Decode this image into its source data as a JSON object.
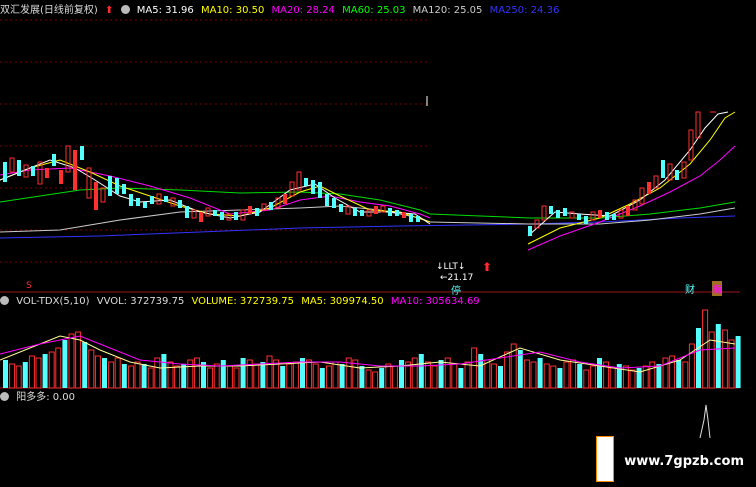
{
  "main_header": {
    "title": "双汇发展(日线前复权)",
    "ma5": "MA5: 31.96",
    "ma10": "MA10: 30.50",
    "ma20": "MA20: 28.24",
    "ma60": "MA60: 25.03",
    "ma120": "MA120: 25.05",
    "ma250": "MA250: 24.36"
  },
  "vol_header": {
    "name": "VOL-TDX(5,10)",
    "vvol": "VVOL: 372739.75",
    "volume": "VOLUME: 372739.75",
    "ma5": "MA5: 309974.50",
    "ma10": "MA10: 305634.69"
  },
  "yang_header": {
    "name": "阳多多",
    "value": ": 0.00"
  },
  "annotations": {
    "price_mark": "←21.17",
    "stop_tag": "停",
    "cai_tag": "财",
    "mei_tag": "梅",
    "s_tag": "S"
  },
  "watermark": "www.7gpzb.com",
  "colors": {
    "ma5": "#ffffff",
    "ma10": "#ffff00",
    "ma20": "#ff00ff",
    "ma60": "#00ff00",
    "ma120": "#cccccc",
    "ma250": "#3333ff",
    "up": "#ff3030",
    "down": "#54ffff"
  }
}
